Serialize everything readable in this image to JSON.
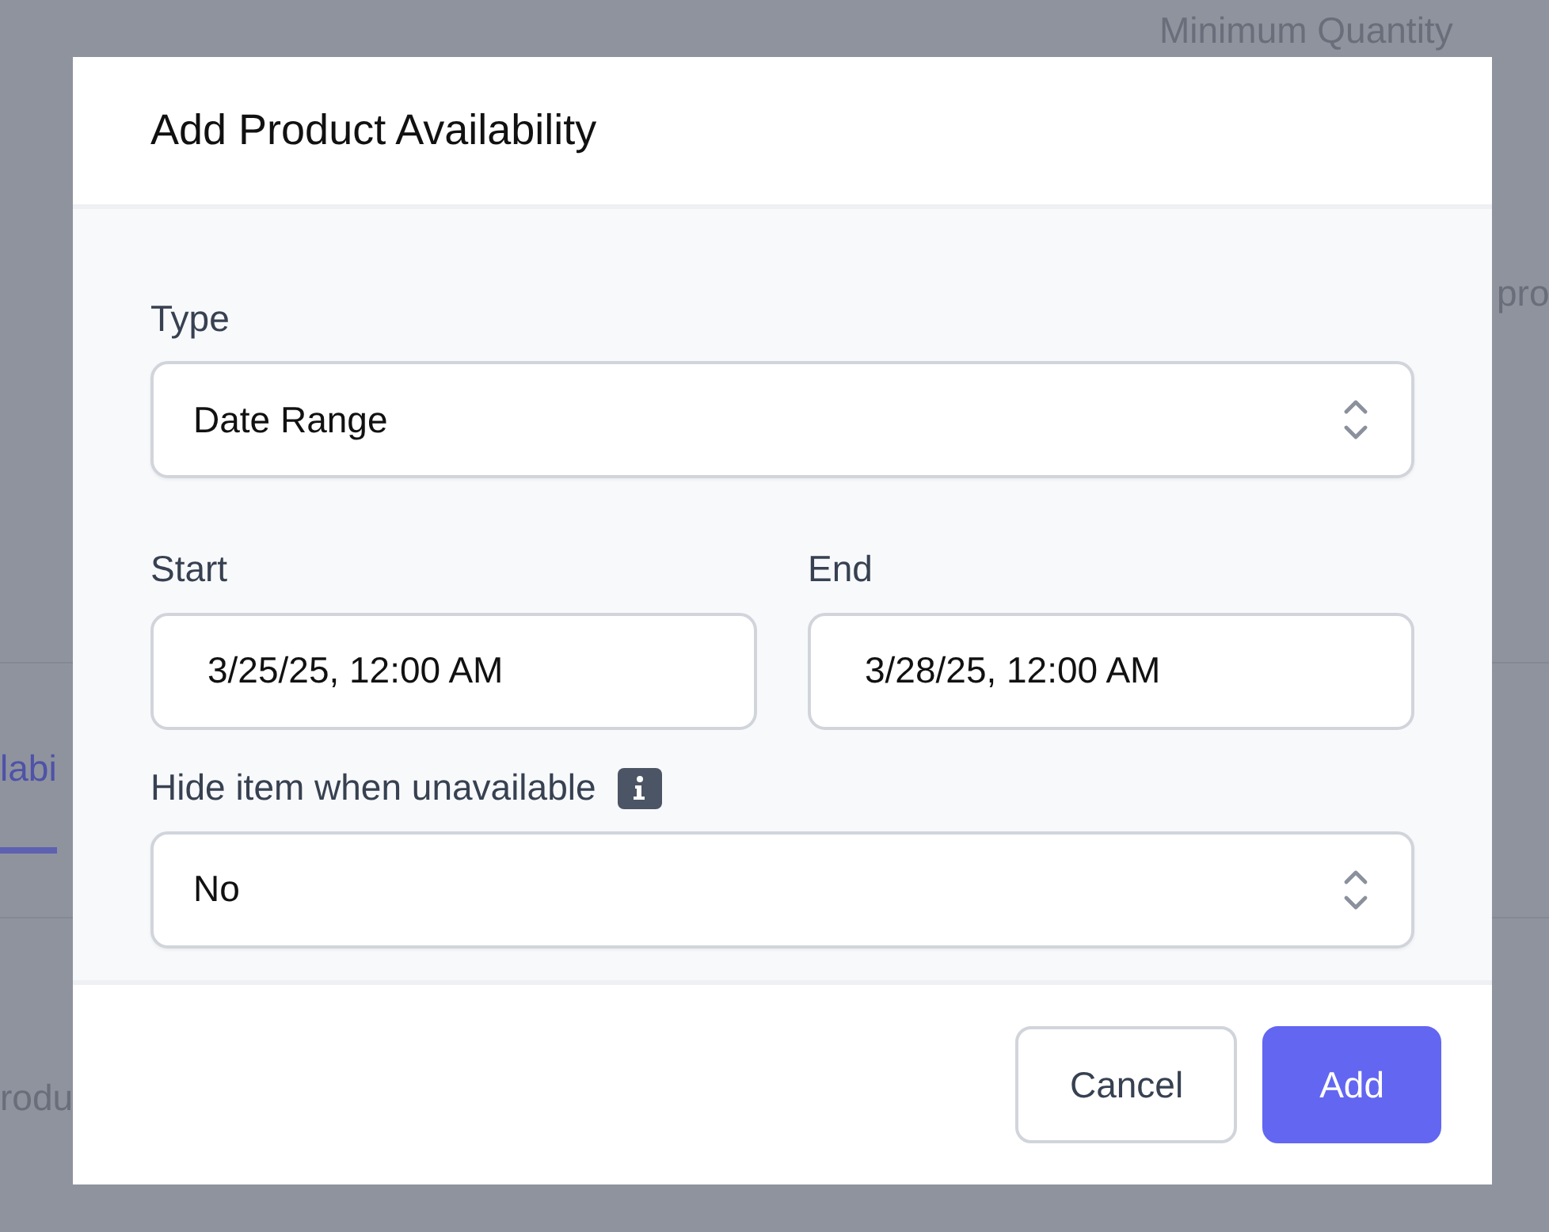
{
  "background": {
    "column_heading": "Minimum Quantity",
    "text_right": "pro",
    "tab": {
      "label": "labi",
      "selected": true
    },
    "text_left": "rodu"
  },
  "dialog": {
    "title": "Add Product Availability",
    "fields": [
      {
        "kind": "select",
        "label": "Type",
        "value": "Date Range",
        "info": false
      },
      {
        "kind": "pair",
        "items": [
          {
            "label": "Start",
            "value": "3/25/25, 12:00 AM"
          },
          {
            "label": "End",
            "value": "3/28/25, 12:00 AM"
          }
        ]
      },
      {
        "kind": "select",
        "label": "Hide item when unavailable",
        "value": "No",
        "info": true
      }
    ],
    "buttons": [
      {
        "label": "Cancel",
        "primary": false
      },
      {
        "label": "Add",
        "primary": true
      }
    ]
  }
}
